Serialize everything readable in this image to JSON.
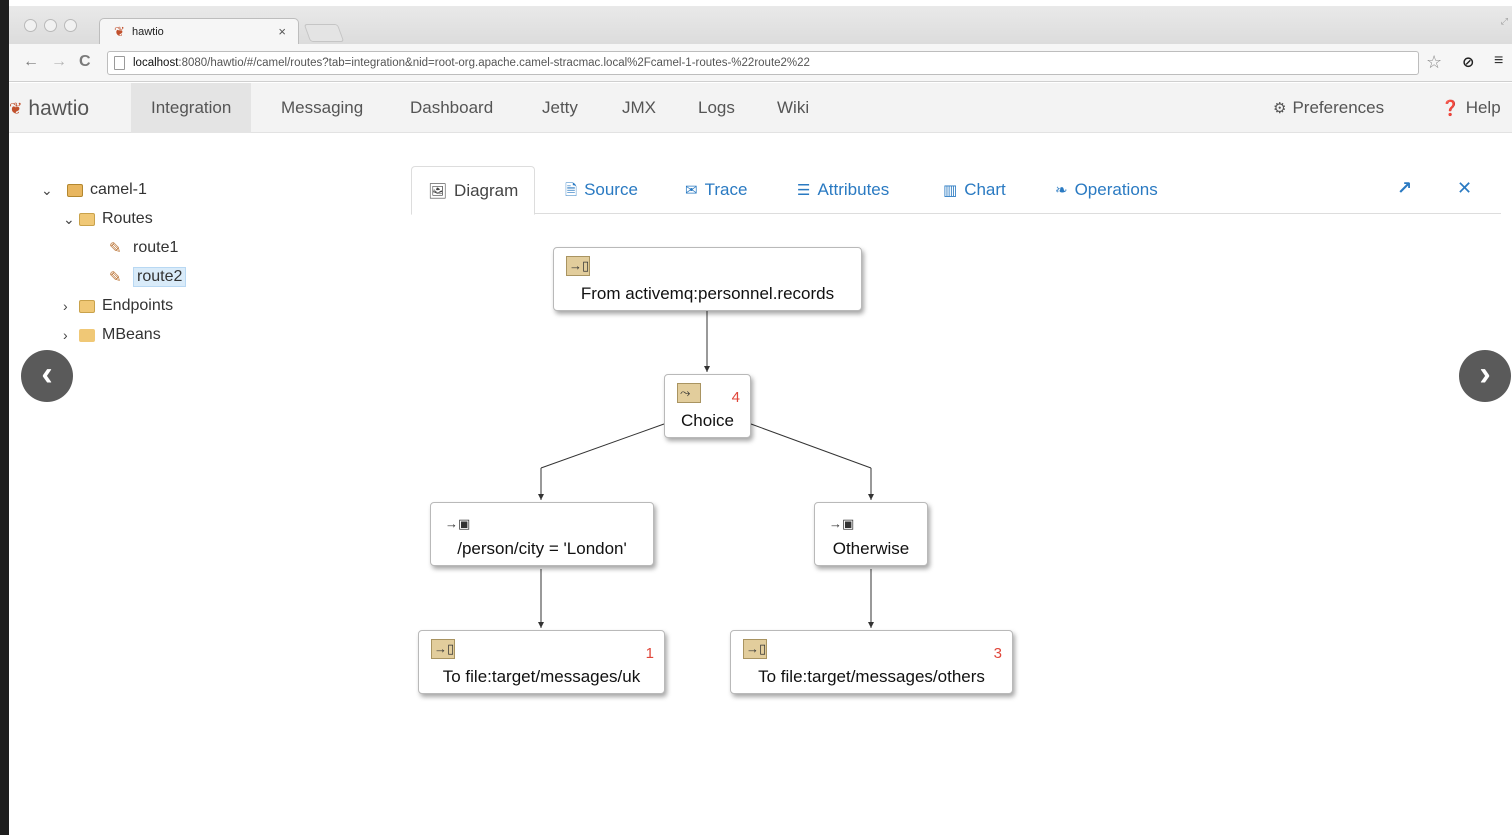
{
  "browser": {
    "tab_title": "hawtio",
    "tab_close": "×",
    "url_host": "localhost",
    "url_rest": ":8080/hawtio/#/camel/routes?tab=integration&nid=root-org.apache.camel-stracmac.local%2Fcamel-1-routes-%22route2%22"
  },
  "navbar": {
    "brand": "hawtio",
    "items": [
      "Integration",
      "Messaging",
      "Dashboard",
      "Jetty",
      "JMX",
      "Logs",
      "Wiki"
    ],
    "preferences": "Preferences",
    "help": "Help"
  },
  "tree": {
    "root": "camel-1",
    "routes": "Routes",
    "route1": "route1",
    "route2": "route2",
    "endpoints": "Endpoints",
    "mbeans": "MBeans"
  },
  "tabs": [
    "Diagram",
    "Source",
    "Trace",
    "Attributes",
    "Chart",
    "Operations"
  ],
  "diagram": {
    "from": "From activemq:personnel.records",
    "choice": "Choice",
    "choice_count": "4",
    "when": "/person/city = 'London'",
    "otherwise": "Otherwise",
    "to_uk": "To file:target/messages/uk",
    "to_uk_count": "1",
    "to_others": "To file:target/messages/others",
    "to_others_count": "3"
  },
  "colors": {
    "link": "#2a7ac2",
    "count": "#e0463a",
    "accent": "#c1502c"
  }
}
